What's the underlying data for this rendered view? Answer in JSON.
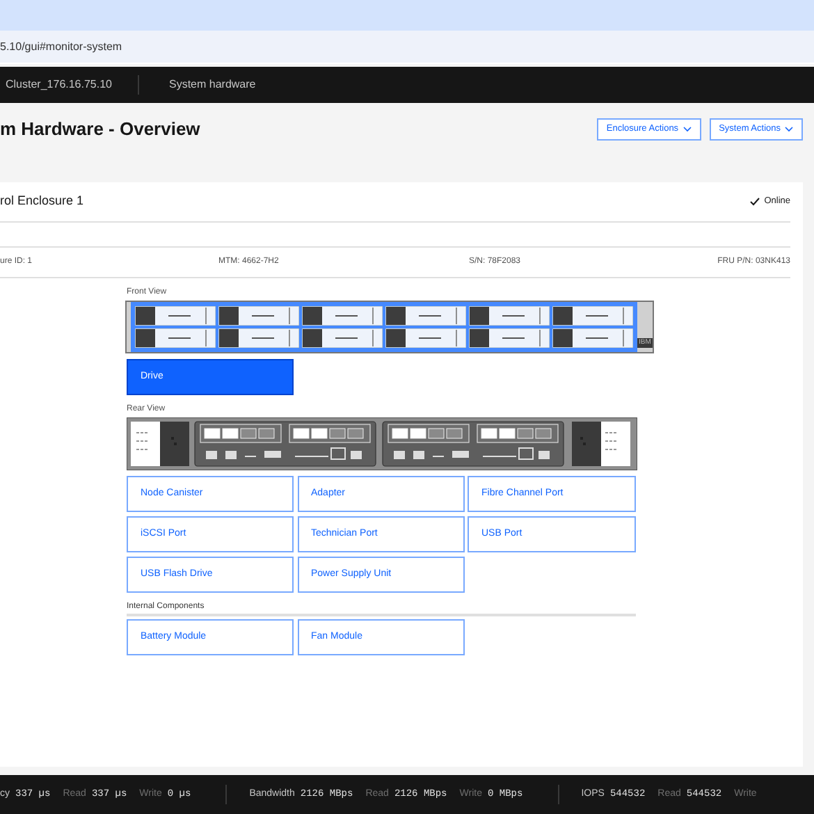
{
  "browser": {
    "url": "5.10/gui#monitor-system"
  },
  "nav": {
    "items": [
      "Cluster_176.16.75.10",
      "System hardware"
    ]
  },
  "page": {
    "title": "m Hardware - Overview",
    "actions": [
      "Enclosure Actions",
      "System Actions"
    ]
  },
  "enclosure": {
    "title": "rol Enclosure 1",
    "status": "Online",
    "details": [
      "ure ID: 1",
      "MTM: 4662-7H2",
      "S/N: 78F2083",
      "FRU P/N: 03NK413"
    ],
    "front_view": {
      "label": "Front View",
      "badge": "IBM",
      "components": [
        {
          "label": "Drive",
          "selected": true
        }
      ]
    },
    "rear_view": {
      "label": "Rear View",
      "components": [
        {
          "label": "Node Canister",
          "selected": false
        },
        {
          "label": "Adapter",
          "selected": false
        },
        {
          "label": "Fibre Channel Port",
          "selected": false
        },
        {
          "label": "iSCSI Port",
          "selected": false
        },
        {
          "label": "Technician Port",
          "selected": false
        },
        {
          "label": "USB Port",
          "selected": false
        },
        {
          "label": "USB Flash Drive",
          "selected": false
        },
        {
          "label": "Power Supply Unit",
          "selected": false
        }
      ]
    },
    "internal": {
      "label": "Internal Components",
      "components": [
        {
          "label": "Battery Module",
          "selected": false
        },
        {
          "label": "Fan Module",
          "selected": false
        }
      ]
    }
  },
  "status_bar": [
    [
      {
        "label": "cy",
        "value": "337 µs"
      },
      {
        "label": "Read",
        "value": "337 µs"
      },
      {
        "label": "Write",
        "value": "0 µs"
      }
    ],
    [
      {
        "label": "Bandwidth",
        "value": "2126 MBps"
      },
      {
        "label": "Read",
        "value": "2126 MBps"
      },
      {
        "label": "Write",
        "value": "0 MBps"
      }
    ],
    [
      {
        "label": "IOPS",
        "value": "544532"
      },
      {
        "label": "Read",
        "value": "544532"
      },
      {
        "label": "Write"
      }
    ]
  ]
}
